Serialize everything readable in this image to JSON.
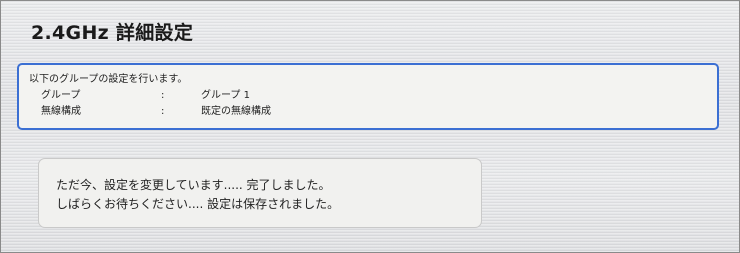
{
  "page": {
    "title": "2.4GHz 詳細設定"
  },
  "info": {
    "intro": "以下のグループの設定を行います。",
    "rows": [
      {
        "label": "グループ",
        "separator": ":",
        "value": "グループ 1"
      },
      {
        "label": "無線構成",
        "separator": ":",
        "value": "既定の無線構成"
      }
    ]
  },
  "status": {
    "line1": "ただ今、設定を変更しています..... 完了しました。",
    "line2": "しばらくお待ちください.... 設定は保存されました。"
  }
}
